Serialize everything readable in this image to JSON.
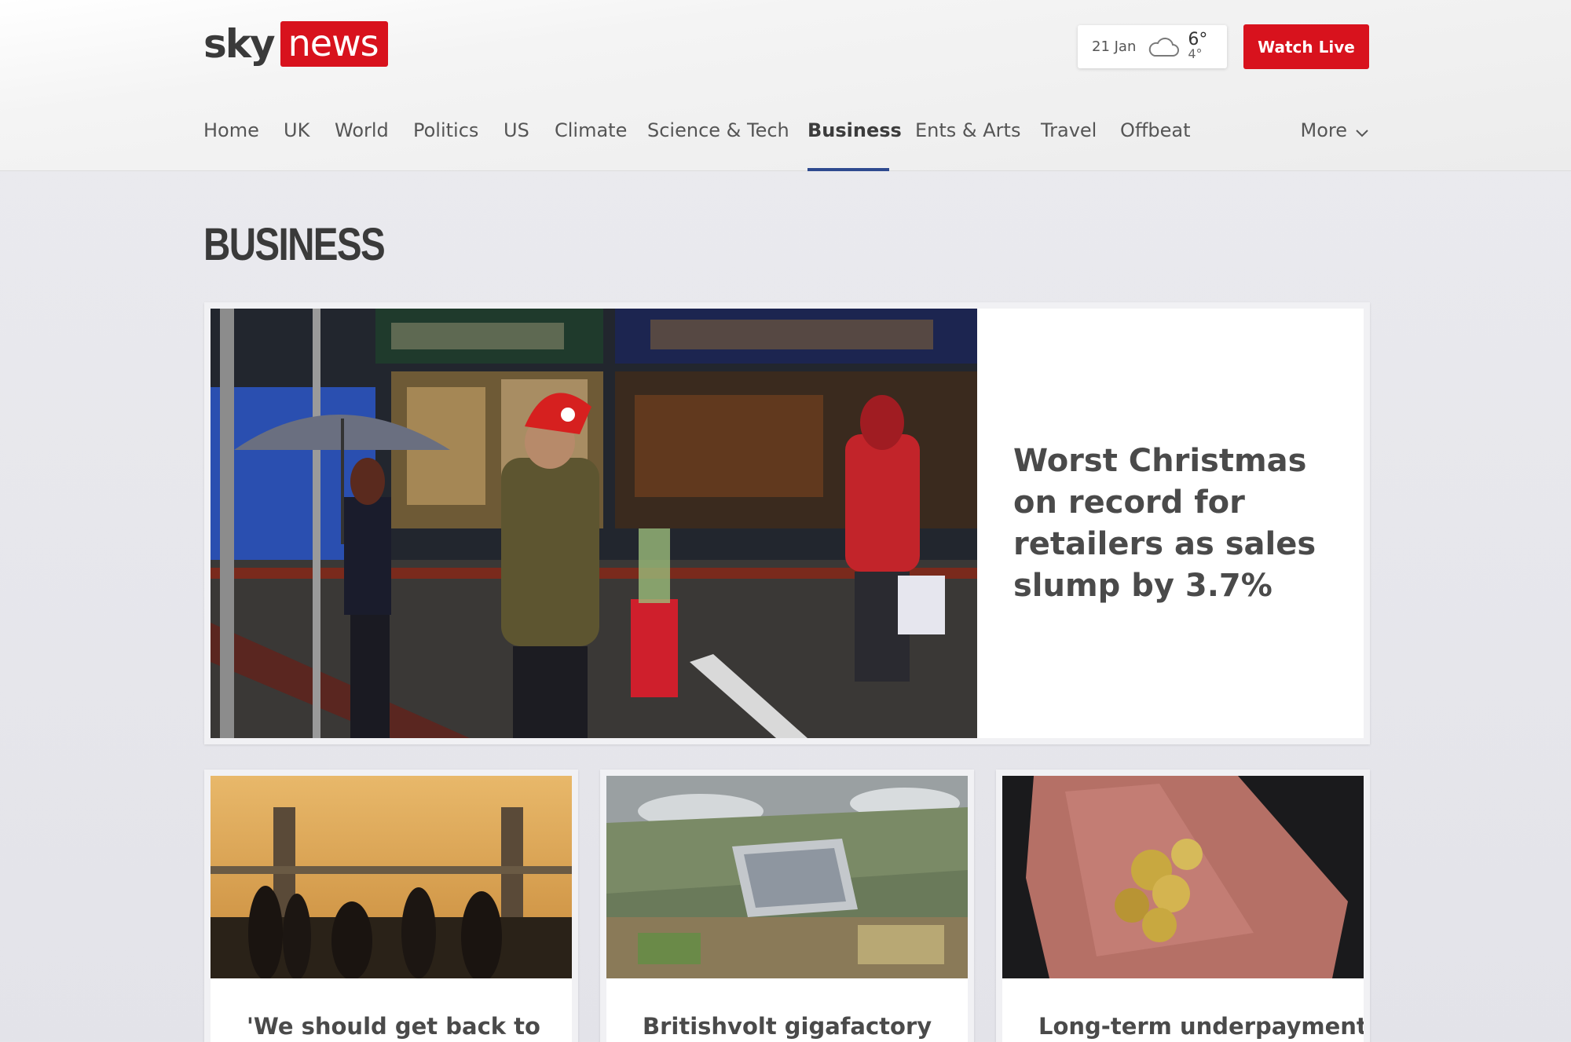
{
  "header": {
    "logo": {
      "part1": "sky",
      "part2": "news"
    },
    "weather": {
      "date": "21 Jan",
      "icon": "cloud-icon",
      "high": "6°",
      "low": "4°"
    },
    "watch_live": "Watch Live"
  },
  "nav": {
    "items": [
      {
        "label": "Home"
      },
      {
        "label": "UK"
      },
      {
        "label": "World"
      },
      {
        "label": "Politics"
      },
      {
        "label": "US"
      },
      {
        "label": "Climate"
      },
      {
        "label": "Science & Tech"
      },
      {
        "label": "Business",
        "active": true
      },
      {
        "label": "Ents & Arts"
      },
      {
        "label": "Travel"
      },
      {
        "label": "Offbeat"
      }
    ],
    "more": "More"
  },
  "page": {
    "title": "BUSINESS"
  },
  "hero": {
    "headline": "Worst Christmas on record for retailers as sales slump by 3.7%"
  },
  "cards": [
    {
      "headline": "'We should get back to"
    },
    {
      "headline": "Britishvolt gigafactory"
    },
    {
      "headline": "Long-term underpayment"
    }
  ],
  "colors": {
    "brand_red": "#d8121d",
    "nav_active": "#2e4a8f"
  }
}
